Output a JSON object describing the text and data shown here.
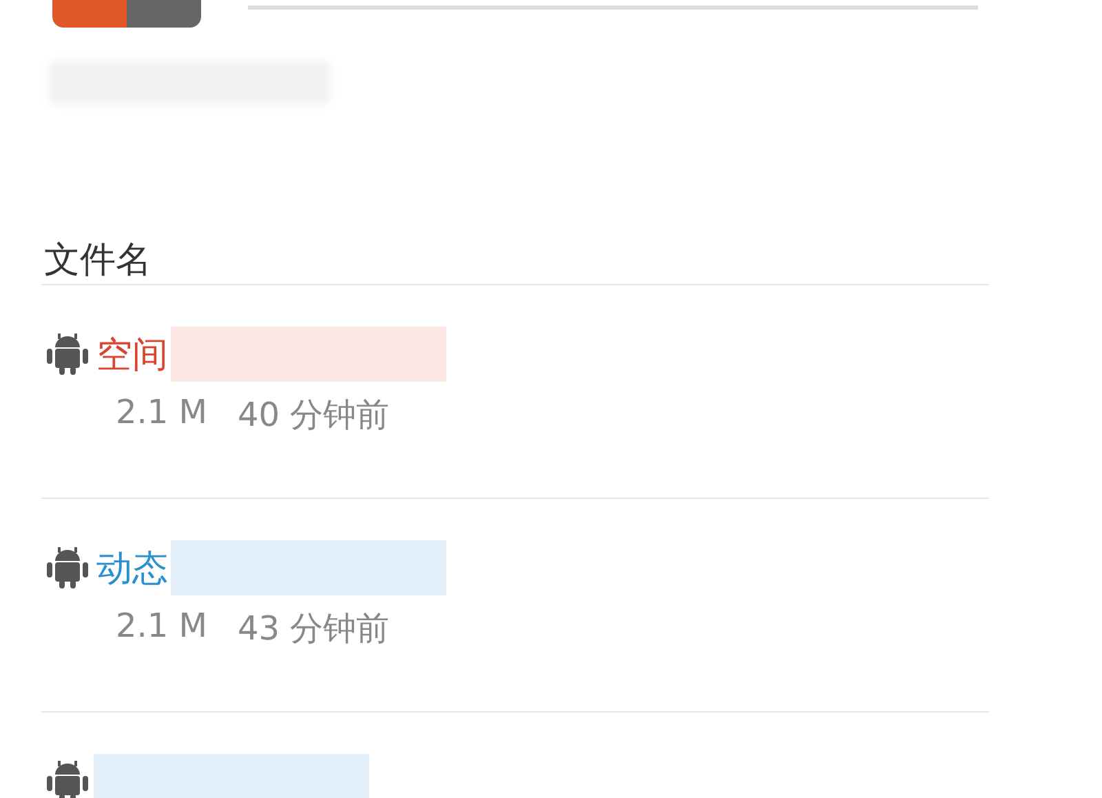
{
  "header": {
    "label": "文件名"
  },
  "files": [
    {
      "name": "空间",
      "size": "2.1 M",
      "time": "40 分钟前",
      "color": "#d9442f"
    },
    {
      "name": "动态",
      "size": "2.1 M",
      "time": "43 分钟前",
      "color": "#2a8fd0"
    },
    {
      "color": "#e2eff9"
    }
  ]
}
